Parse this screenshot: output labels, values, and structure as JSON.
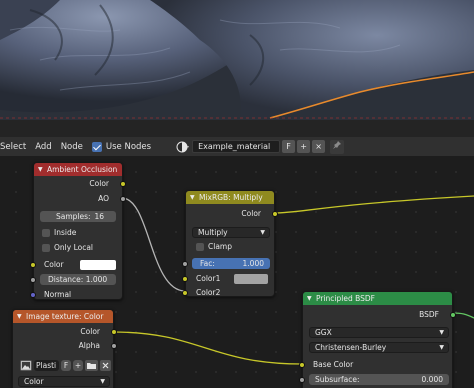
{
  "header": {
    "menus": [
      "Select",
      "Add",
      "Node"
    ],
    "use_nodes_label": "Use Nodes",
    "use_nodes_checked": true,
    "material_name": "Example_material",
    "fake_user_label": "F",
    "new_label": "+",
    "unlink_label": "×"
  },
  "nodes": {
    "ao": {
      "title": "Ambient Occlusion",
      "color": "#a12d2d",
      "out_color": "Color",
      "out_ao": "AO",
      "samples_label": "Samples:",
      "samples_value": "16",
      "inside_label": "Inside",
      "only_local_label": "Only Local",
      "in_color": "Color",
      "distance": "Distance: 1.000",
      "in_normal": "Normal"
    },
    "mix": {
      "title": "MixRGB: Multiply",
      "color": "#8f8a1f",
      "out_color": "Color",
      "blend_mode": "Multiply",
      "clamp_label": "Clamp",
      "fac_label": "Fac:",
      "fac_value": "1.000",
      "fac_fraction": 1.0,
      "color1": "Color1",
      "color2": "Color2"
    },
    "img": {
      "title": "Image texture: Color",
      "color": "#b5562a",
      "out_color": "Color",
      "out_alpha": "Alpha",
      "image_name": "Plasti",
      "fake_user_label": "F",
      "new_label": "+",
      "color_space": "Color"
    },
    "bsdf": {
      "title": "Principled BSDF",
      "color": "#2c8c46",
      "out_bsdf": "BSDF",
      "distribution": "GGX",
      "subsurface_method": "Christensen-Burley",
      "in_base_color": "Base Color",
      "subsurface_label": "Subsurface:",
      "subsurface_value": "0.000"
    }
  },
  "colors": {
    "socket_color": "#c7c729",
    "socket_float": "#a1a1a1",
    "socket_vector": "#6363c7",
    "socket_shader": "#63c763",
    "selection_outline": "#e88a2c",
    "slider_blue": "#4772b3"
  },
  "icons": [
    "material-sphere-icon",
    "pin-icon",
    "image-icon",
    "folder-icon",
    "checkbox-icon"
  ]
}
